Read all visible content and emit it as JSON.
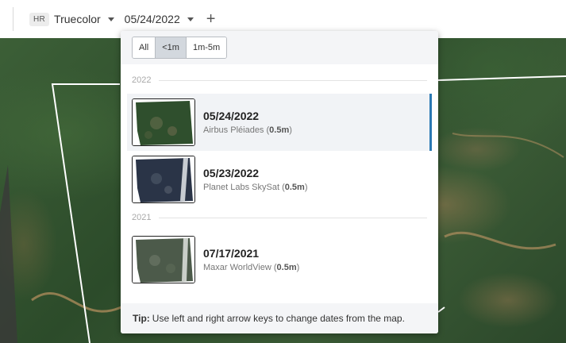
{
  "toolbar": {
    "badge": "HR",
    "layer_label": "Truecolor",
    "date_label": "05/24/2022",
    "add_label": "+"
  },
  "filters": [
    {
      "label": "All",
      "active": false
    },
    {
      "label": "<1m",
      "active": true
    },
    {
      "label": "1m-5m",
      "active": false
    }
  ],
  "years": [
    "2022",
    "2021"
  ],
  "items": [
    {
      "date": "05/24/2022",
      "provider": "Airbus Pléiades",
      "resolution": "0.5m",
      "selected": true
    },
    {
      "date": "05/23/2022",
      "provider": "Planet Labs SkySat",
      "resolution": "0.5m",
      "selected": false
    },
    {
      "date": "07/17/2021",
      "provider": "Maxar WorldView",
      "resolution": "0.5m",
      "selected": false
    }
  ],
  "tip": {
    "label": "Tip:",
    "text": "Use left and right arrow keys to change dates from the map."
  },
  "colors": {
    "accent": "#2b79b3",
    "panel_header": "#f4f5f7"
  }
}
